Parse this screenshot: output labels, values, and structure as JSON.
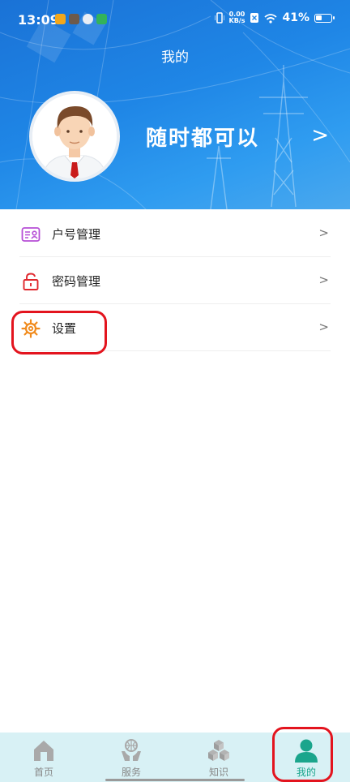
{
  "status_bar": {
    "time": "13:09",
    "net_speed_value": "0.00",
    "net_speed_unit": "KB/s",
    "battery_percent": "41%",
    "battery_level": 0.41
  },
  "header": {
    "title": "我的",
    "user_name": "随时都可以",
    "arrow": ">"
  },
  "menu": {
    "items": [
      {
        "label": "户号管理",
        "icon": "account-card-icon",
        "arrow": ">"
      },
      {
        "label": "密码管理",
        "icon": "lock-icon",
        "arrow": ">"
      },
      {
        "label": "设置",
        "icon": "gear-icon",
        "arrow": ">"
      }
    ]
  },
  "bottom_nav": {
    "items": [
      {
        "label": "首页",
        "icon": "home-icon",
        "active": false
      },
      {
        "label": "服务",
        "icon": "service-icon",
        "active": false
      },
      {
        "label": "知识",
        "icon": "knowledge-icon",
        "active": false
      },
      {
        "label": "我的",
        "icon": "person-icon",
        "active": true
      }
    ]
  },
  "colors": {
    "header_blue": "#1f86e6",
    "active_green": "#1aa58c",
    "annotation_red": "#e3141e",
    "nav_background": "#d8f1f5"
  }
}
